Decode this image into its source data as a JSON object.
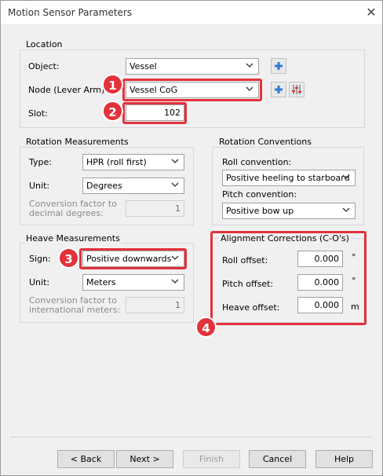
{
  "window": {
    "title": "Motion Sensor Parameters",
    "close_glyph": "✕"
  },
  "location": {
    "label": "Location",
    "object_label": "Object:",
    "object_value": "Vessel",
    "node_label": "Node (Lever Arm):",
    "node_value": "Vessel CoG",
    "slot_label": "Slot:",
    "slot_value": "102"
  },
  "rotation_measurements": {
    "label": "Rotation Measurements",
    "type_label": "Type:",
    "type_value": "HPR (roll first)",
    "unit_label": "Unit:",
    "unit_value": "Degrees",
    "conversion_label": "Conversion factor to decimal degrees:",
    "conversion_value": "1"
  },
  "rotation_conventions": {
    "label": "Rotation Conventions",
    "roll_label": "Roll convention:",
    "roll_value": "Positive heeling to starboard",
    "pitch_label": "Pitch convention:",
    "pitch_value": "Positive bow up"
  },
  "heave_measurements": {
    "label": "Heave Measurements",
    "sign_label": "Sign:",
    "sign_value": "Positive downwards",
    "unit_label": "Unit:",
    "unit_value": "Meters",
    "conversion_label": "Conversion factor to international meters:",
    "conversion_value": "1"
  },
  "alignment_corrections": {
    "label": "Alignment Corrections (C-O's)",
    "roll_label": "Roll offset:",
    "roll_value": "0.000",
    "roll_unit": "°",
    "pitch_label": "Pitch offset:",
    "pitch_value": "0.000",
    "pitch_unit": "°",
    "heave_label": "Heave offset:",
    "heave_value": "0.000",
    "heave_unit": "m"
  },
  "badges": [
    "1",
    "2",
    "3",
    "4"
  ],
  "buttons": {
    "back": "< Back",
    "next": "Next >",
    "finish": "Finish",
    "cancel": "Cancel",
    "help": "Help"
  },
  "colors": {
    "highlight": "#e2323c",
    "icon_blue": "#2e7bd6"
  }
}
